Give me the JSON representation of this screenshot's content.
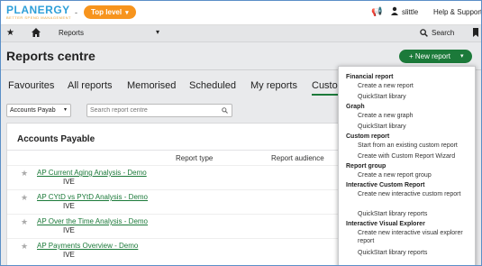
{
  "app": {
    "logo": "PLANERGY",
    "logo_tagline": "BETTER SPEND MANAGEMENT",
    "separator": "-",
    "level": "Top level",
    "user": "slittle",
    "help": "Help & Support"
  },
  "nav": {
    "section": "Reports",
    "search": "Search"
  },
  "page": {
    "title": "Reports centre",
    "new_report": "+ New report"
  },
  "tabs": [
    "Favourites",
    "All reports",
    "Memorised",
    "Scheduled",
    "My reports",
    "Custom"
  ],
  "filters": {
    "category": "Accounts Payab",
    "search_placeholder": "Search report centre"
  },
  "card": {
    "title": "Accounts Payable",
    "columns": [
      "Report type",
      "Report audience"
    ],
    "rows": [
      {
        "name": "AP Current Aging Analysis - Demo",
        "tag": "IVE"
      },
      {
        "name": "AP CYtD vs PYtD Analysis - Demo",
        "tag": "IVE"
      },
      {
        "name": "AP Over the Time Analysis - Demo",
        "tag": "IVE"
      },
      {
        "name": "AP Payments Overview - Demo",
        "tag": "IVE"
      }
    ]
  },
  "menu": {
    "financial_report": "Financial report",
    "create_new_report": "Create a new report",
    "quickstart_library": "QuickStart library",
    "graph": "Graph",
    "create_new_graph": "Create a new graph",
    "quickstart_library_2": "QuickStart library",
    "custom_report": "Custom report",
    "start_existing": "Start from an existing custom report",
    "create_wizard": "Create with Custom Report Wizard",
    "report_group": "Report group",
    "create_report_group": "Create a new report group",
    "interactive_custom_report": "Interactive Custom Report",
    "create_interactive_custom": "Create new interactive custom report",
    "quickstart_library_reports": "QuickStart library reports",
    "interactive_visual_explorer": "Interactive Visual Explorer",
    "create_interactive_visual": "Create new interactive visual explorer report",
    "quickstart_library_reports_2": "QuickStart library reports"
  },
  "colors": {
    "brand_blue": "#2e9fd8",
    "accent_orange": "#f7941d",
    "primary_green": "#1c7a3a"
  }
}
